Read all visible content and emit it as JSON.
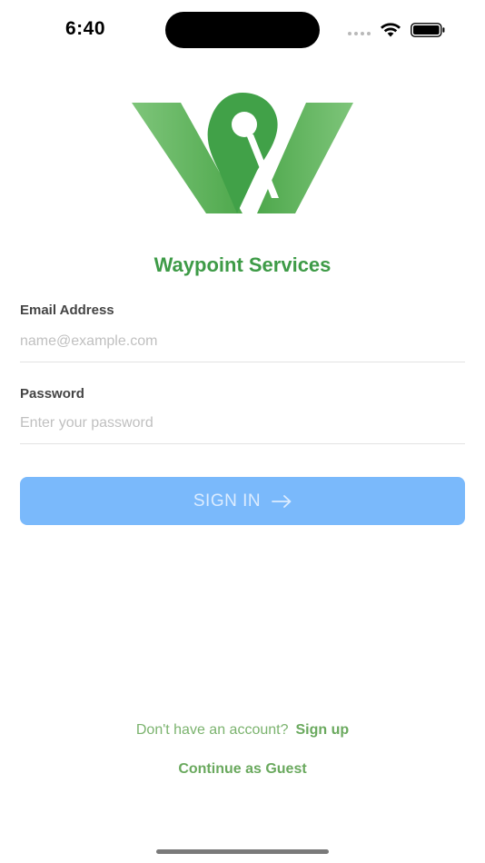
{
  "status_bar": {
    "time": "6:40",
    "icons": [
      "signal-dots-icon",
      "wifi-icon",
      "battery-icon"
    ]
  },
  "brand": {
    "title": "Waypoint Services",
    "logo_icon": "waypoint-w-logo",
    "primary_color": "#3e9b47"
  },
  "form": {
    "email": {
      "label": "Email Address",
      "placeholder": "name@example.com",
      "value": ""
    },
    "password": {
      "label": "Password",
      "placeholder": "Enter your password",
      "value": ""
    },
    "submit": {
      "label": "SIGN IN",
      "icon": "arrow-right-icon",
      "color": "#7ab9fb"
    }
  },
  "footer": {
    "signup_prompt": "Don't have an account?",
    "signup_link": "Sign up",
    "guest_link": "Continue as Guest"
  }
}
